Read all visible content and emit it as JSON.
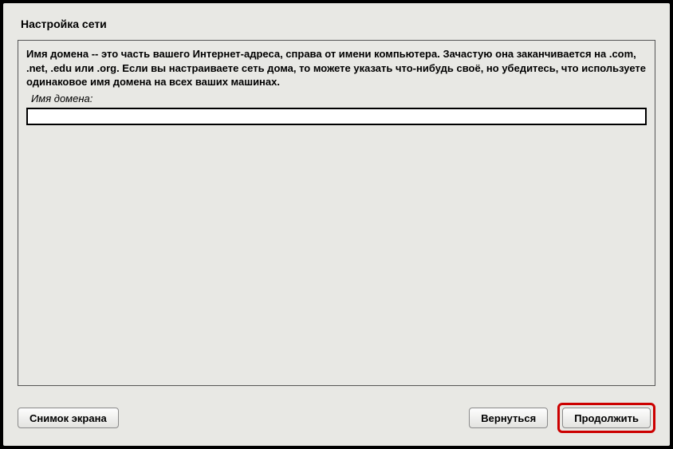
{
  "title": "Настройка сети",
  "main": {
    "description": "Имя домена -- это часть вашего Интернет-адреса, справа от имени компьютера. Зачастую она заканчивается на .com, .net, .edu или .org. Если вы настраиваете сеть дома, то можете указать что-нибудь своё, но убедитесь, что используете одинаковое имя домена на всех ваших машинах.",
    "field_label": "Имя домена:",
    "field_value": ""
  },
  "buttons": {
    "screenshot": "Снимок экрана",
    "back": "Вернуться",
    "continue": "Продолжить"
  }
}
